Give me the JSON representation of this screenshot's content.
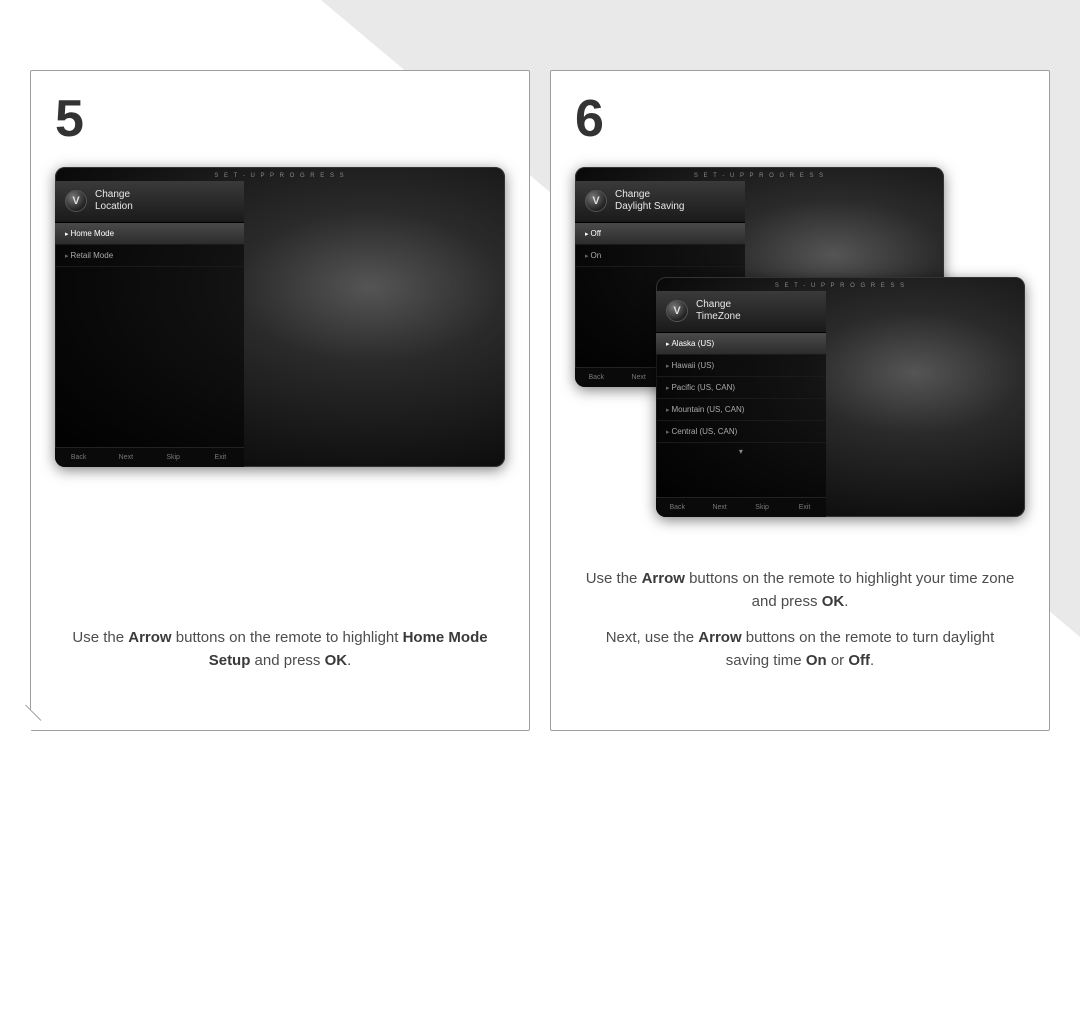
{
  "steps": {
    "left": {
      "number": "5",
      "instruction_html": "Use the <b>Arrow</b> buttons on the remote to highlight <b>Home Mode Setup</b> and press <b>OK</b>."
    },
    "right": {
      "number": "6",
      "instruction1_html": "Use the <b>Arrow</b> buttons on the remote to highlight your time zone and press <b>OK</b>.",
      "instruction2_html": "Next, use the <b>Arrow</b> buttons on the remote to turn daylight saving time <b>On</b> or <b>Off</b>."
    }
  },
  "tv_common": {
    "setup_label": "S E T - U P   P R O G R E S S",
    "logo_glyph": "V",
    "footer": [
      "Back",
      "Next",
      "Skip",
      "Exit"
    ]
  },
  "tv_location": {
    "title_line1": "Change",
    "title_line2": "Location",
    "items": [
      {
        "label": "Home Mode",
        "selected": true
      },
      {
        "label": "Retail Mode",
        "selected": false
      }
    ]
  },
  "tv_daylight": {
    "title_line1": "Change",
    "title_line2": "Daylight Saving",
    "items": [
      {
        "label": "Off",
        "selected": true
      },
      {
        "label": "On",
        "selected": false
      }
    ]
  },
  "tv_timezone": {
    "title_line1": "Change",
    "title_line2": "TimeZone",
    "items": [
      {
        "label": "Alaska (US)",
        "selected": true
      },
      {
        "label": "Hawaii (US)",
        "selected": false
      },
      {
        "label": "Pacific (US, CAN)",
        "selected": false
      },
      {
        "label": "Mountain (US, CAN)",
        "selected": false
      },
      {
        "label": "Central (US, CAN)",
        "selected": false
      }
    ]
  }
}
